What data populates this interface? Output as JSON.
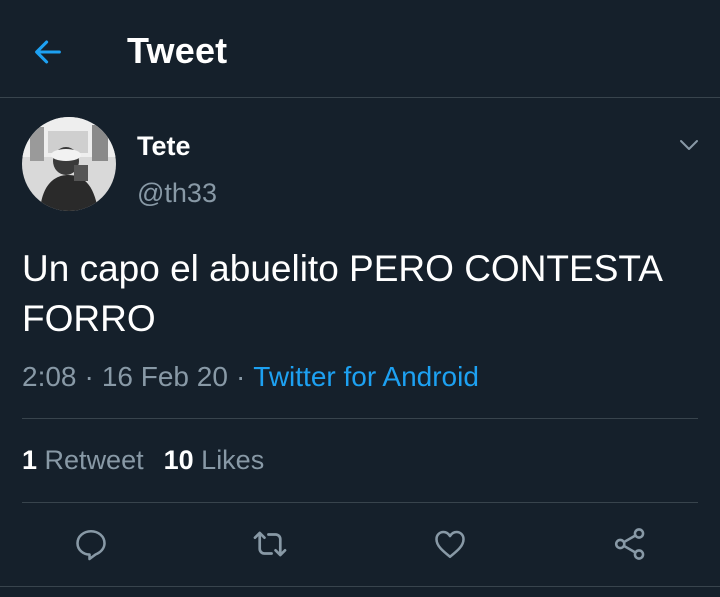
{
  "header": {
    "title": "Tweet",
    "back_icon": "arrow-left-icon"
  },
  "colors": {
    "background": "#15202b",
    "accent": "#1da1f2",
    "secondary_text": "#8899a6",
    "divider": "#38444d"
  },
  "tweet": {
    "author": {
      "display_name": "Tete",
      "handle": "@th33"
    },
    "text": "Un capo el abuelito PERO CONTESTA FORRO",
    "time": "2:08",
    "date": "16 Feb 20",
    "separator": "·",
    "source": "Twitter for Android",
    "stats": {
      "retweets": "1",
      "retweets_label": "Retweet",
      "likes": "10",
      "likes_label": "Likes"
    }
  },
  "actions": [
    {
      "icon": "reply-icon"
    },
    {
      "icon": "retweet-icon"
    },
    {
      "icon": "like-icon"
    },
    {
      "icon": "share-icon"
    }
  ]
}
